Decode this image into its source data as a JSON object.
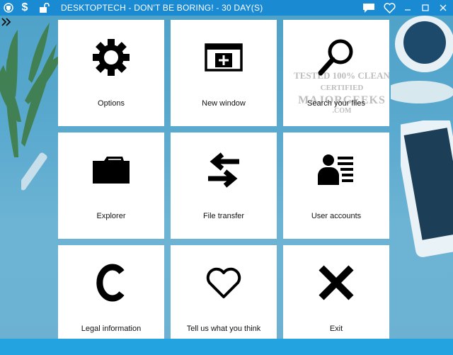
{
  "window": {
    "title": "DESKTOPTECH - DON'T BE BORING! - 30 DAY(S)"
  },
  "titlebar": {
    "left_icons": [
      "app-logo-icon",
      "dollar-icon",
      "unlock-icon"
    ],
    "right_icons": [
      "chat-icon",
      "heart-icon",
      "minimize-icon",
      "maximize-icon",
      "close-icon"
    ],
    "dollar_glyph": "$"
  },
  "tiles": [
    {
      "label": "Options",
      "icon": "gear-icon"
    },
    {
      "label": "New window",
      "icon": "new-window-icon"
    },
    {
      "label": "Search your files",
      "icon": "magnifier-icon"
    },
    {
      "label": "Explorer",
      "icon": "folder-icon"
    },
    {
      "label": "File transfer",
      "icon": "transfer-arrows-icon"
    },
    {
      "label": "User accounts",
      "icon": "user-accounts-icon"
    },
    {
      "label": "Legal information",
      "icon": "copyright-c-icon"
    },
    {
      "label": "Tell us what you think",
      "icon": "heart-outline-icon"
    },
    {
      "label": "Exit",
      "icon": "x-icon"
    }
  ],
  "watermark": {
    "line1": "TESTED 100% CLEAN",
    "line2": "CERTIFIED",
    "line3": "MAJORGEEKS",
    "line4": ".COM"
  },
  "colors": {
    "titlebar": "#1a8ad3",
    "statusbar": "#23a3df",
    "desktop": "#5aa9cf"
  }
}
